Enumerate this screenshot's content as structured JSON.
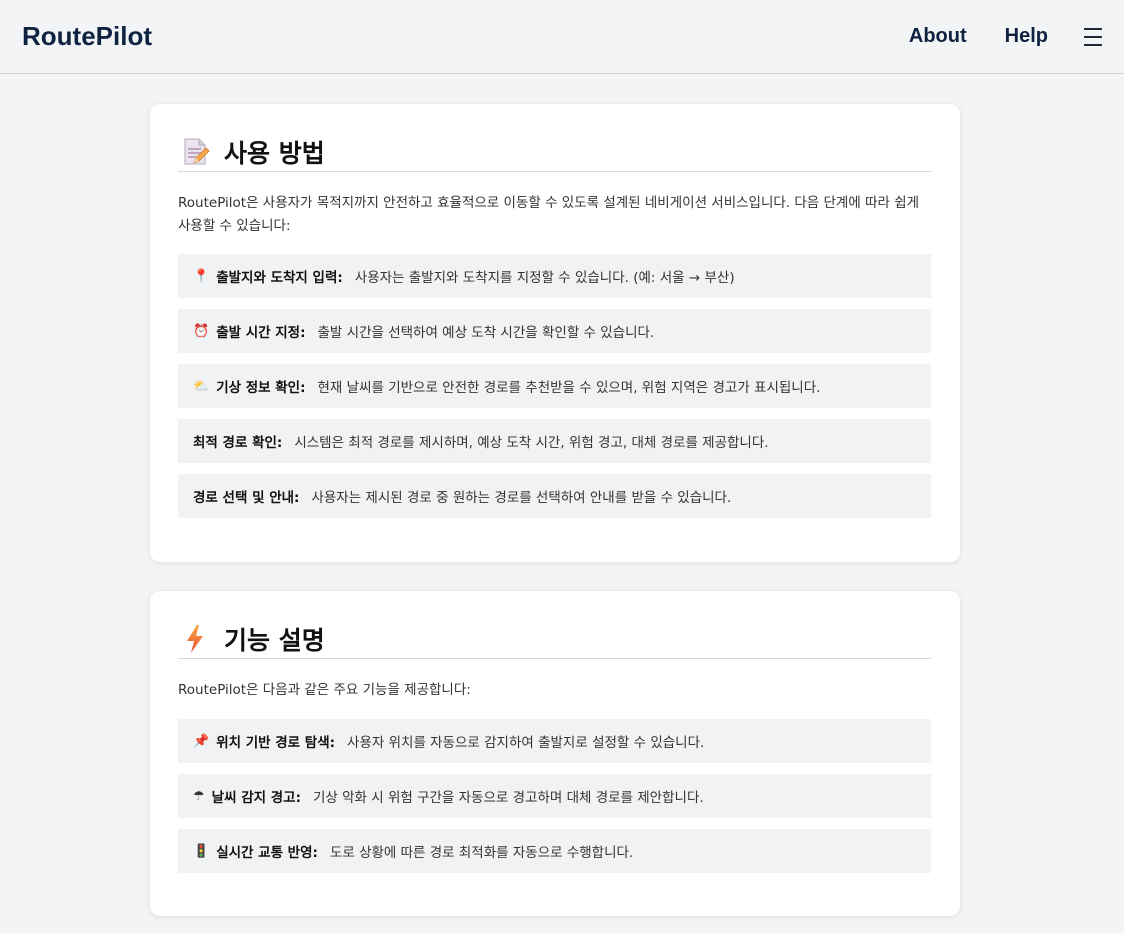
{
  "nav": {
    "brand": "RoutePilot",
    "links": [
      "About",
      "Help"
    ],
    "menu_icon": "hamburger-menu-icon"
  },
  "usage": {
    "icon": "memo-icon",
    "title": "사용 방법",
    "intro": "RoutePilot은 사용자가 목적지까지 안전하고 효율적으로 이동할 수 있도록 설계된 네비게이션 서비스입니다. 다음 단계에 따라 쉽게 사용할 수 있습니다:",
    "items": [
      {
        "emoji": "📍",
        "icon": "pin-icon",
        "label": "출발지와 도착지 입력:",
        "text": "사용자는 출발지와 도착지를 지정할 수 있습니다. (예: 서울 → 부산)"
      },
      {
        "emoji": "⏰",
        "icon": "alarm-clock-icon",
        "label": "출발 시간 지정:",
        "text": "출발 시간을 선택하여 예상 도착 시간을 확인할 수 있습니다."
      },
      {
        "emoji": "⛅",
        "icon": "cloud-icon",
        "label": "기상 정보 확인:",
        "text": "현재 날씨를 기반으로 안전한 경로를 추천받을 수 있으며, 위험 지역은 경고가 표시됩니다."
      },
      {
        "emoji": "",
        "icon": "",
        "label": "최적 경로 확인:",
        "text": "시스템은 최적 경로를 제시하며, 예상 도착 시간, 위험 경고, 대체 경로를 제공합니다."
      },
      {
        "emoji": "",
        "icon": "",
        "label": "경로 선택 및 안내:",
        "text": "사용자는 제시된 경로 중 원하는 경로를 선택하여 안내를 받을 수 있습니다."
      }
    ]
  },
  "features": {
    "icon": "lightning-icon",
    "title": "기능 설명",
    "intro": "RoutePilot은 다음과 같은 주요 기능을 제공합니다:",
    "items": [
      {
        "emoji": "📌",
        "icon": "pushpin-icon",
        "label": "위치 기반 경로 탐색:",
        "text": "사용자 위치를 자동으로 감지하여 출발지로 설정할 수 있습니다."
      },
      {
        "emoji": "☂",
        "icon": "umbrella-icon",
        "label": "날씨 감지 경고:",
        "text": "기상 악화 시 위험 구간을 자동으로 경고하며 대체 경로를 제안합니다."
      },
      {
        "emoji": "🚦",
        "icon": "traffic-light-icon",
        "label": "실시간 교통 반영:",
        "text": "도로 상황에 따른 경로 최적화를 자동으로 수행합니다."
      }
    ]
  }
}
